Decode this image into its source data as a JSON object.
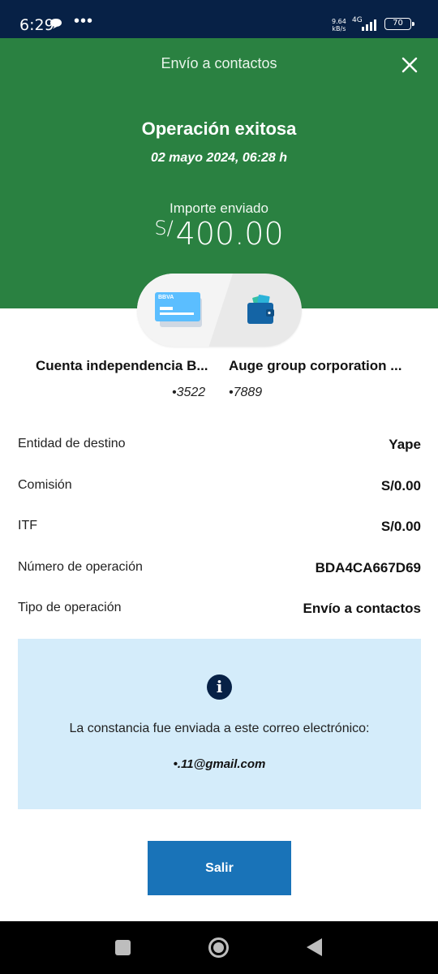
{
  "status_bar": {
    "time": "6:29",
    "dots": "•••",
    "speed_value": "9.64",
    "speed_unit": "kB/s",
    "network": "4G",
    "battery": "70"
  },
  "header": {
    "title": "Envío a contactos",
    "status": "Operación exitosa",
    "date": "02 mayo 2024, 06:28 h",
    "amount_label": "Importe enviado",
    "currency_symbol": "S/",
    "amount": "400.00",
    "color": "#2a8141"
  },
  "transfer": {
    "card_brand": "BBVA",
    "from_name": "Cuenta independencia B...",
    "from_number": "•3522",
    "to_name": "Auge group corporation ...",
    "to_number": "•7889"
  },
  "details": [
    {
      "label": "Entidad de destino",
      "value": "Yape"
    },
    {
      "label": "Comisión",
      "value": "S/0.00"
    },
    {
      "label": "ITF",
      "value": "S/0.00"
    },
    {
      "label": "Número de operación",
      "value": "BDA4CA667D69"
    },
    {
      "label": "Tipo de operación",
      "value": "Envío a contactos"
    }
  ],
  "info": {
    "icon": "info-icon",
    "message": "La constancia fue enviada a este correo electrónico:",
    "email": "•.11@gmail.com"
  },
  "exit_label": "Salir",
  "colors": {
    "primary_button": "#1973b8",
    "info_background": "#d4ecfa",
    "navy": "#072146"
  }
}
